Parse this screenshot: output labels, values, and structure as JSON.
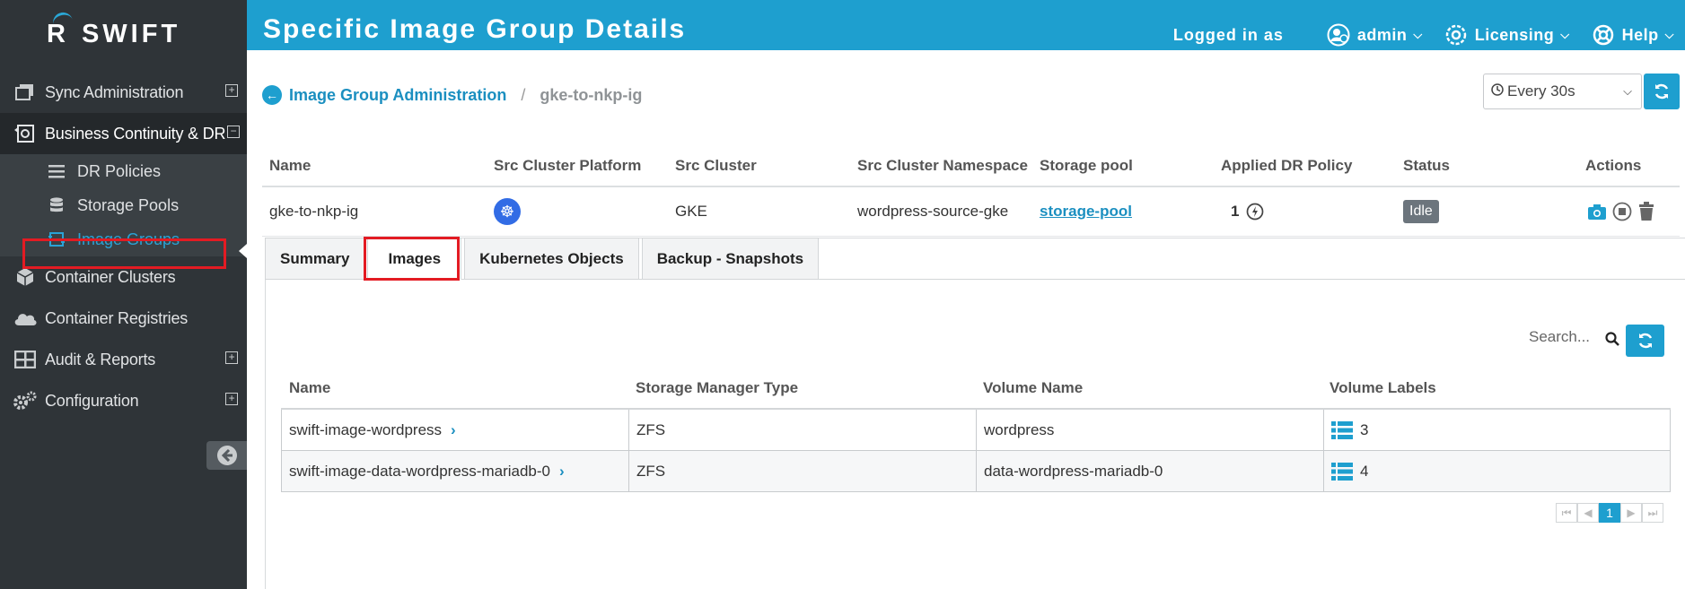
{
  "app": {
    "logo_r": "R",
    "logo_text": "SWIFT"
  },
  "sidebar": {
    "items": [
      {
        "label": "Sync Administration",
        "icon": "copy-icon",
        "expand": "plus"
      },
      {
        "label": "Business Continuity & DR",
        "icon": "continuity-icon",
        "expand": "minus",
        "children": [
          {
            "label": "DR Policies",
            "icon": "list-icon"
          },
          {
            "label": "Storage Pools",
            "icon": "database-icon"
          },
          {
            "label": "Image Groups",
            "icon": "image-group-icon",
            "selected": true
          }
        ]
      },
      {
        "label": "Container Clusters",
        "icon": "cube-icon"
      },
      {
        "label": "Container Registries",
        "icon": "cloud-icon"
      },
      {
        "label": "Audit & Reports",
        "icon": "table-icon",
        "expand": "plus"
      },
      {
        "label": "Configuration",
        "icon": "gears-icon",
        "expand": "plus"
      }
    ]
  },
  "header": {
    "title": "Specific Image Group Details",
    "logged_in_label": "Logged in as",
    "user": "admin",
    "licensing": "Licensing",
    "help": "Help"
  },
  "breadcrumb": {
    "parent": "Image Group Administration",
    "separator": "/",
    "current": "gke-to-nkp-ig"
  },
  "refresh": {
    "selected": "Every 30s"
  },
  "group_table": {
    "columns": [
      "Name",
      "Src Cluster Platform",
      "Src Cluster",
      "Src Cluster Namespace",
      "Storage pool",
      "Applied DR Policy",
      "Status",
      "Actions"
    ],
    "row": {
      "name": "gke-to-nkp-ig",
      "platform_icon": "kubernetes-icon",
      "src_cluster": "GKE",
      "namespace": "wordpress-source-gke",
      "storage_pool": "storage-pool",
      "dr_policy_count": "1",
      "status": "Idle"
    }
  },
  "tabs": [
    {
      "label": "Summary"
    },
    {
      "label": "Images",
      "active": true
    },
    {
      "label": "Kubernetes Objects"
    },
    {
      "label": "Backup - Snapshots"
    }
  ],
  "images": {
    "search_placeholder": "Search...",
    "columns": [
      "Name",
      "Storage Manager Type",
      "Volume Name",
      "Volume Labels"
    ],
    "rows": [
      {
        "name": "swift-image-wordpress",
        "type": "ZFS",
        "volume": "wordpress",
        "labels": "3"
      },
      {
        "name": "swift-image-data-wordpress-mariadb-0",
        "type": "ZFS",
        "volume": "data-wordpress-mariadb-0",
        "labels": "4"
      }
    ],
    "current_page": "1"
  },
  "colors": {
    "accent": "#1e9fcf",
    "sidebar": "#2f3438",
    "highlight": "#e31b23"
  }
}
